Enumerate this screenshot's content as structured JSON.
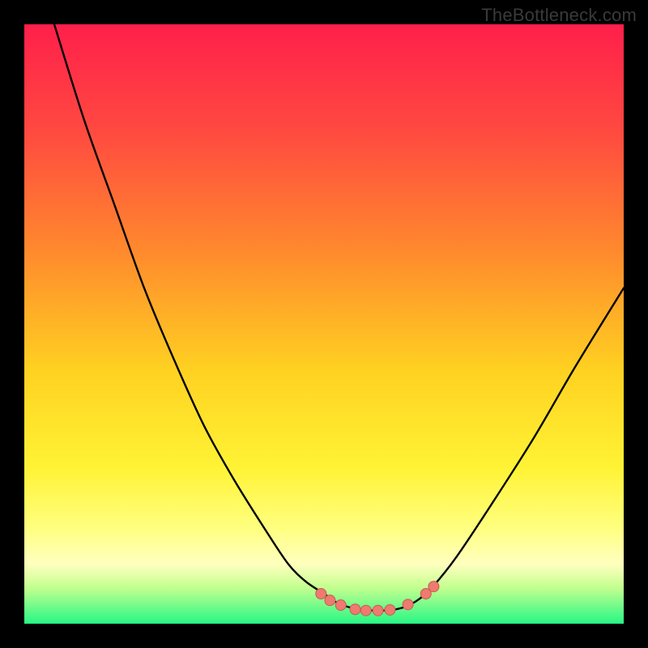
{
  "watermark": {
    "text": "TheBottleneck.com"
  },
  "colors": {
    "frame": "#000000",
    "curve_stroke": "#000000",
    "marker_fill": "#ee7a70",
    "marker_stroke": "#c95b52",
    "gradient_stops": [
      "#ff1f4b",
      "#ff4a40",
      "#ff8a2d",
      "#ffd221",
      "#fff335",
      "#ffff7f",
      "#ffffbf",
      "#c3ff8f",
      "#27f785"
    ]
  },
  "chart_data": {
    "type": "line",
    "title": "",
    "xlabel": "",
    "ylabel": "",
    "xlim": [
      0,
      100
    ],
    "ylim": [
      0,
      100
    ],
    "series": [
      {
        "name": "bottleneck-curve",
        "x": [
          5,
          10,
          15,
          20,
          25,
          30,
          35,
          40,
          44,
          47,
          50,
          52,
          54,
          56,
          58,
          60,
          62,
          64,
          66,
          68,
          72,
          78,
          85,
          92,
          100
        ],
        "y": [
          100,
          84,
          70,
          56,
          44,
          33,
          24,
          16,
          10,
          7,
          5,
          3.6,
          2.8,
          2.4,
          2.2,
          2.2,
          2.4,
          3,
          4.2,
          6,
          11,
          20,
          31,
          43,
          56
        ]
      }
    ],
    "markers": [
      {
        "name": "marker-left-3",
        "x": 49.5,
        "y": 5.0
      },
      {
        "name": "marker-left-2",
        "x": 51.0,
        "y": 3.9
      },
      {
        "name": "marker-left-1",
        "x": 52.8,
        "y": 3.1
      },
      {
        "name": "marker-min-1",
        "x": 55.2,
        "y": 2.4
      },
      {
        "name": "marker-min-2",
        "x": 57.0,
        "y": 2.2
      },
      {
        "name": "marker-min-3",
        "x": 59.0,
        "y": 2.2
      },
      {
        "name": "marker-min-4",
        "x": 61.0,
        "y": 2.3
      },
      {
        "name": "marker-right-1",
        "x": 64.0,
        "y": 3.2
      },
      {
        "name": "marker-right-2",
        "x": 67.0,
        "y": 5.0
      },
      {
        "name": "marker-right-3",
        "x": 68.3,
        "y": 6.2
      }
    ]
  }
}
